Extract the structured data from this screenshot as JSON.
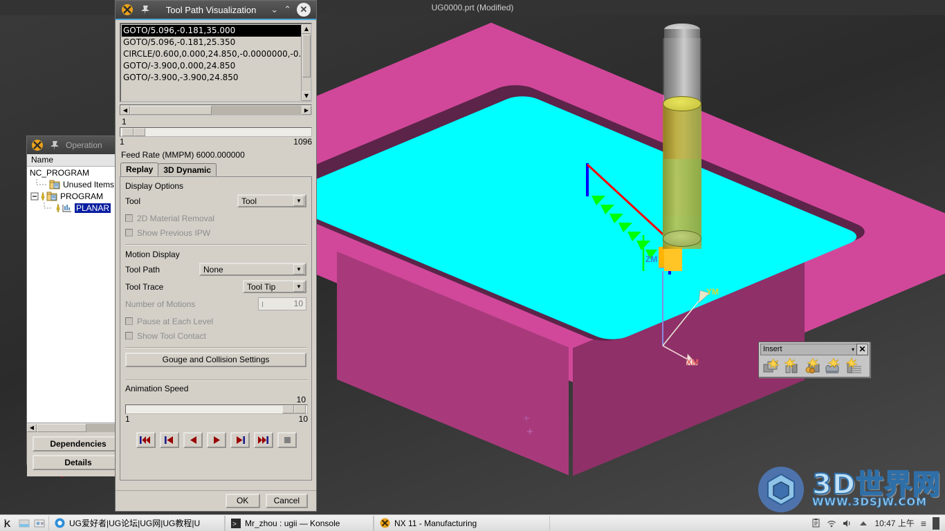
{
  "nx_window": {
    "title": "UG0000.prt (Modified)"
  },
  "viewport": {
    "axes": {
      "zm": "ZM",
      "ym": "YM",
      "xm": "XM"
    },
    "colors": {
      "block_top": "#d1489a",
      "block_front": "#a83a7c",
      "pocket_wall": "#5c2449",
      "pocket_floor": "#00ffff",
      "toolpath_red": "#ff0000",
      "toolpath_green": "#00ff00",
      "toolpath_blue": "#0000ff",
      "cutter_orange": "#ffc425",
      "background": "#2e2e2e"
    }
  },
  "insert_toolbar": {
    "title": "Insert",
    "close_label": "✕",
    "dropdown_glyph": "▾",
    "icons": [
      "create-geometry-icon",
      "create-tool-icon",
      "create-method-icon",
      "create-operation-icon",
      "create-program-icon"
    ]
  },
  "watermark": {
    "main": "3D世界网",
    "sub": "WWW.3DSJW.COM"
  },
  "operation_navigator": {
    "title": "Operation",
    "column_header": "Name",
    "tree": [
      {
        "label": "NC_PROGRAM",
        "indent": 0,
        "selected": false,
        "icon": "none"
      },
      {
        "label": "Unused Items",
        "indent": 1,
        "selected": false,
        "icon": "folder-icon"
      },
      {
        "label": "PROGRAM",
        "indent": 1,
        "selected": false,
        "icon": "folder-icon"
      },
      {
        "label": "PLANAR",
        "indent": 2,
        "selected": true,
        "icon": "operation-icon"
      }
    ],
    "buttons": [
      {
        "label": "Dependencies"
      },
      {
        "label": "Details"
      }
    ]
  },
  "tool_path_visualization": {
    "title": "Tool Path Visualization",
    "titlebar_icons": {
      "app": "nx-app-icon",
      "pin": "pin-icon",
      "collapse": "chevron-down-icon",
      "expand": "chevron-up-icon",
      "close": "close-icon"
    },
    "goto_list": [
      {
        "text": "GOTO/5.096,-0.181,35.000",
        "selected": true
      },
      {
        "text": "GOTO/5.096,-0.181,25.350",
        "selected": false
      },
      {
        "text": "CIRCLE/0.600,0.000,24.850,-0.0000000,-0.",
        "selected": false
      },
      {
        "text": "GOTO/-3.900,0.000,24.850",
        "selected": false
      },
      {
        "text": "GOTO/-3.900,-3.900,24.850",
        "selected": false
      }
    ],
    "position_label": "1",
    "motion_slider": {
      "min": "1",
      "max": "1096",
      "value": "1"
    },
    "feed_rate": "Feed Rate (MMPM) 6000.000000",
    "tabs": [
      {
        "label": "Replay",
        "active": true
      },
      {
        "label": "3D Dynamic",
        "active": false
      }
    ],
    "display_options": {
      "group_label": "Display Options",
      "tool_label": "Tool",
      "tool_value": "Tool",
      "checkboxes": [
        {
          "label": "2D Material Removal",
          "checked": false,
          "enabled": false
        },
        {
          "label": "Show Previous IPW",
          "checked": false,
          "enabled": false
        }
      ]
    },
    "motion_display": {
      "group_label": "Motion Display",
      "tool_path_label": "Tool Path",
      "tool_path_value": "None",
      "tool_trace_label": "Tool Trace",
      "tool_trace_value": "Tool Tip",
      "number_of_motions_label": "Number of Motions",
      "number_of_motions_value": "10",
      "checkboxes": [
        {
          "label": "Pause at Each Level",
          "checked": false,
          "enabled": false
        },
        {
          "label": "Show Tool Contact",
          "checked": false,
          "enabled": false
        }
      ],
      "gouge_button": "Gouge and Collision Settings"
    },
    "animation_speed": {
      "label": "Animation Speed",
      "value": "10",
      "min": "1",
      "max": "10"
    },
    "playback_buttons": [
      {
        "name": "rewind-to-start-button",
        "glyph": "rewind-start"
      },
      {
        "name": "step-back-button",
        "glyph": "step-back"
      },
      {
        "name": "play-backward-button",
        "glyph": "play-back"
      },
      {
        "name": "play-forward-button",
        "glyph": "play-fwd"
      },
      {
        "name": "step-forward-button",
        "glyph": "step-fwd"
      },
      {
        "name": "forward-to-end-button",
        "glyph": "fwd-end"
      },
      {
        "name": "stop-button",
        "glyph": "stop"
      }
    ],
    "footer": {
      "ok": "OK",
      "cancel": "Cancel"
    }
  },
  "taskbar": {
    "system_icons": [
      "kde-menu-icon",
      "show-desktop-icon",
      "display-settings-icon"
    ],
    "tasks": [
      {
        "label": "UG爱好者|UG论坛|UG网|UG教程|U",
        "icon": "browser-icon"
      },
      {
        "label": "Mr_zhou : ugii — Konsole",
        "icon": "konsole-icon"
      },
      {
        "label": "NX 11 - Manufacturing",
        "icon": "nx-icon"
      }
    ],
    "tray_icons": [
      "clipboard-icon",
      "network-icon",
      "volume-icon",
      "show-hidden-icon"
    ],
    "clock": "10:47 上午",
    "menu_glyph": "≡"
  }
}
